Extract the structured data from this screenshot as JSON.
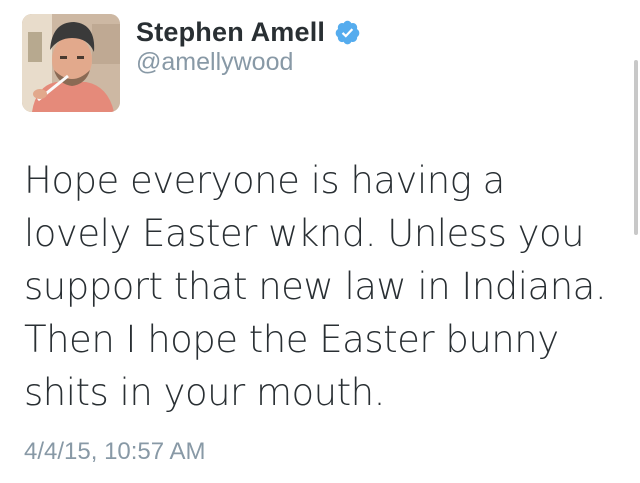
{
  "tweet": {
    "display_name": "Stephen Amell",
    "handle": "@amellywood",
    "verified": true,
    "text": "Hope everyone is having a lovely Easter wknd. Unless you support that new law in Indiana. Then I hope the Easter bunny shits in your mouth.",
    "timestamp": "4/4/15, 10:57 AM"
  },
  "icons": {
    "verified": "verified-badge-icon",
    "avatar": "profile-photo"
  },
  "colors": {
    "name": "#292f33",
    "muted": "#8899a6",
    "verified_badge": "#55acee",
    "background": "#ffffff"
  }
}
